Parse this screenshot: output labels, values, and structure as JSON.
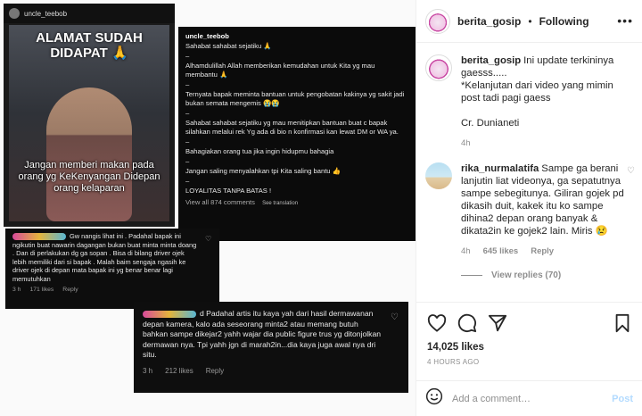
{
  "header": {
    "username": "berita_gosip",
    "separator": "•",
    "follow_label": "Following",
    "more_icon": "more-horizontal-icon"
  },
  "media": {
    "card1": {
      "username": "uncle_teebob",
      "title": "ALAMAT SUDAH DIDAPAT 🙏",
      "caption": "Jangan memberi makan pada orang yg KeKenyangan Didepan orang kelaparan"
    },
    "card2": {
      "username": "uncle_teebob",
      "lines": [
        "Sahabat sahabat sejatiku 🙏",
        "–",
        "Alhamdulillah Allah memberikan kemudahan untuk Kita yg mau membantu 🙏",
        "–",
        "Ternyata bapak meminta bantuan untuk pengobatan kakinya yg sakit jadi bukan semata mengemis 😭😭",
        "–",
        "Sahabat sahabat sejatiku yg mau menitipkan bantuan buat c bapak silahkan melalui rek Yg ada di bio n konfirmasi kan lewat DM or WA ya.",
        "–",
        "Bahagiakan orang tua jika ingin hidupmu bahagia",
        "–",
        "Jangan saling menyalahkan tpi Kita saling bantu 👍",
        "–",
        "LOYALITAS TANPA BATAS !"
      ],
      "view_all": "View all 874 comments",
      "see_translation": "See translation"
    },
    "card3": {
      "text": "Gw nangis lihat ini . Padahal bapak ini ngikutin buat nawarin dagangan bukan buat minta minta doang . Dan di perlakukan dg ga sopan . Bisa di bilang driver ojek lebih memiliki dari si bapak . Malah baim sengaja ngasih ke driver ojek di depan mata bapak ini yg benar benar lagi memutuhkan",
      "time": "3 h",
      "likes": "171 likes",
      "reply": "Reply"
    },
    "card4": {
      "text": "d Padahal artis itu kaya yah dari hasil dermawanan depan kamera, kalo ada seseorang minta2 atau memang butuh bahkan sampe dikejar2 yahh wajar dia public figure trus yg ditonjolkan dermawan nya. Tpi yahh jgn di marah2in...dia kaya juga awal nya dri situ.",
      "time": "3 h",
      "likes": "212 likes",
      "reply": "Reply"
    }
  },
  "comments": [
    {
      "username": "berita_gosip",
      "text": "Ini update terkininya gaesss.....\n*Kelanjutan dari video yang mimin post tadi pagi gaess\n\nCr. Dunianeti",
      "time": "4h"
    },
    {
      "username": "rika_nurmalatifa",
      "text": "Sampe ga berani lanjutin liat videonya, ga sepatutnya sampe sebegitunya. Giliran gojek pd dikasih duit, kakek itu ko sampe dihina2 depan orang banyak & dikata2in ke gojek2 lain. Miris 😢",
      "time": "4h",
      "likes": "645 likes",
      "reply": "Reply",
      "view_replies": "View replies (70)"
    }
  ],
  "actions": {
    "likes": "14,025 likes",
    "time_ago": "4 HOURS AGO"
  },
  "add_comment": {
    "placeholder": "Add a comment…",
    "post_label": "Post"
  }
}
